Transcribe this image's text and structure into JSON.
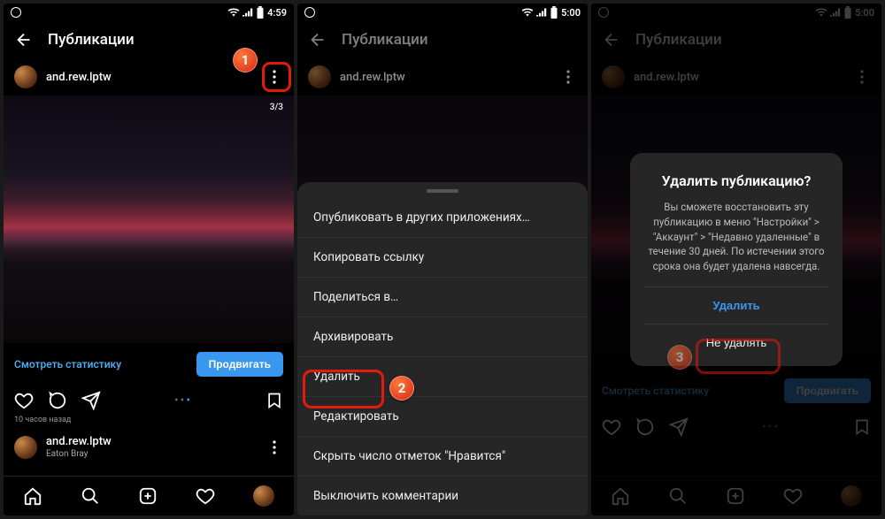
{
  "status": {
    "time1": "4:59",
    "time2": "5:00",
    "time3": "5:00"
  },
  "header": {
    "title": "Публикации"
  },
  "user": {
    "name": "and.rew.lptw",
    "location": "Eaton Bray"
  },
  "post": {
    "counter": "3/3",
    "stats_link": "Смотреть статистику",
    "promote": "Продвигать",
    "time_ago": "10 часов назад"
  },
  "sheet": {
    "share_apps": "Опубликовать в других приложениях…",
    "copy_link": "Копировать ссылку",
    "share_to": "Поделиться в…",
    "archive": "Архивировать",
    "delete": "Удалить",
    "edit": "Редактировать",
    "hide_likes": "Скрыть число отметок \"Нравится\"",
    "disable_comments": "Выключить комментарии"
  },
  "dialog": {
    "title": "Удалить публикацию?",
    "body": "Вы сможете восстановить эту публикацию в меню \"Настройки\" > \"Аккаунт\" > \"Недавно удаленные\" в течение 30 дней. По истечении этого срока она будет удалена навсегда.",
    "confirm": "Удалить",
    "cancel": "Не удалять"
  }
}
